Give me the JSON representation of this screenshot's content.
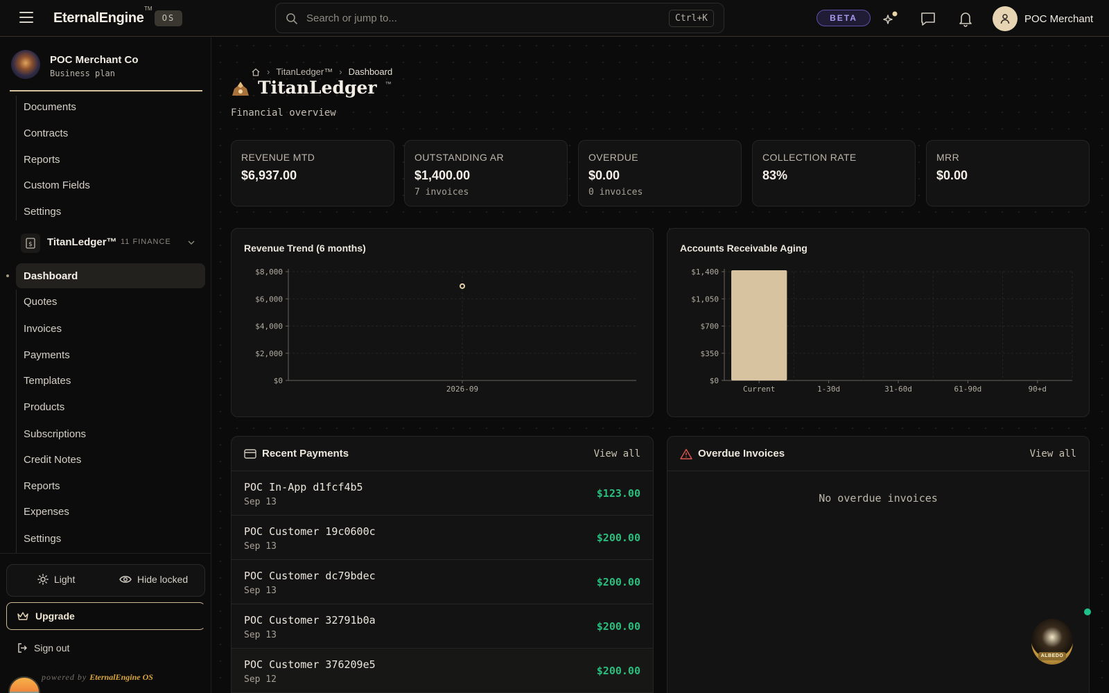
{
  "topbar": {
    "brand": "EternalEngine",
    "brand_tm": "TM",
    "os_badge": "OS",
    "search_placeholder": "Search or jump to...",
    "search_shortcut": "Ctrl+K",
    "beta_label": "BETA",
    "user_name": "POC Merchant",
    "icons": [
      "menu-icon",
      "search-icon",
      "sparkle-icon",
      "chat-icon",
      "bell-icon",
      "user-icon"
    ]
  },
  "sidebar": {
    "org_name": "POC Merchant Co",
    "org_plan": "Business plan",
    "top_items": [
      "Documents",
      "Contracts",
      "Reports",
      "Custom Fields",
      "Settings"
    ],
    "section": {
      "name": "TitanLedger™",
      "meta": "11 FINANCE"
    },
    "section_items": [
      "Dashboard",
      "Quotes",
      "Invoices",
      "Payments",
      "Templates",
      "Products",
      "Subscriptions",
      "Credit Notes",
      "Reports",
      "Expenses",
      "Settings"
    ],
    "active_item": "Dashboard",
    "theme_label": "Light",
    "hide_locked_label": "Hide locked",
    "upgrade_label": "Upgrade",
    "signout_label": "Sign out",
    "powered_prefix": "powered by",
    "powered_brand": "EternalEngine OS"
  },
  "main": {
    "breadcrumb": [
      "TitanLedger™",
      "Dashboard"
    ],
    "title": "TitanLedger",
    "title_tm": "™",
    "subtitle": "Financial overview",
    "kpis": [
      {
        "label": "REVENUE MTD",
        "value": "$6,937.00",
        "sub": ""
      },
      {
        "label": "OUTSTANDING AR",
        "value": "$1,400.00",
        "sub": "7 invoices"
      },
      {
        "label": "OVERDUE",
        "value": "$0.00",
        "sub": "0 invoices"
      },
      {
        "label": "COLLECTION RATE",
        "value": "83%",
        "sub": ""
      },
      {
        "label": "MRR",
        "value": "$0.00",
        "sub": ""
      }
    ],
    "recent_payments": {
      "title": "Recent Payments",
      "view_all": "View all",
      "rows": [
        {
          "name": "POC In-App d1fcf4b5",
          "date": "Sep 13",
          "amount": "$123.00"
        },
        {
          "name": "POC Customer 19c0600c",
          "date": "Sep 13",
          "amount": "$200.00"
        },
        {
          "name": "POC Customer dc79bdec",
          "date": "Sep 13",
          "amount": "$200.00"
        },
        {
          "name": "POC Customer 32791b0a",
          "date": "Sep 13",
          "amount": "$200.00"
        },
        {
          "name": "POC Customer 376209e5",
          "date": "Sep 12",
          "amount": "$200.00"
        }
      ]
    },
    "overdue_invoices": {
      "title": "Overdue Invoices",
      "view_all": "View all",
      "empty_text": "No overdue invoices"
    },
    "assistant_label": "ALBEDO"
  },
  "colors": {
    "accent": "#d8c3a0",
    "positive": "#2bbd7e",
    "beta": "#a99af0",
    "warning": "#e0554f"
  },
  "chart_data": [
    {
      "type": "line",
      "title": "Revenue Trend (6 months)",
      "x": [
        "2026-09"
      ],
      "series": [
        {
          "values": [
            6937
          ]
        }
      ],
      "ylim": [
        0,
        8000
      ],
      "yticks": [
        "$0",
        "$2,000",
        "$4,000",
        "$6,000",
        "$8,000"
      ],
      "yvalues": [
        0,
        2000,
        4000,
        6000,
        8000
      ],
      "grid": true
    },
    {
      "type": "bar",
      "title": "Accounts Receivable Aging",
      "categories": [
        "Current",
        "1-30d",
        "31-60d",
        "61-90d",
        "90+d"
      ],
      "values": [
        1400,
        0,
        0,
        0,
        0
      ],
      "ylim": [
        0,
        1400
      ],
      "yticks": [
        "$0",
        "$350",
        "$700",
        "$1,050",
        "$1,400"
      ],
      "yvalues": [
        0,
        350,
        700,
        1050,
        1400
      ],
      "grid": true
    }
  ]
}
